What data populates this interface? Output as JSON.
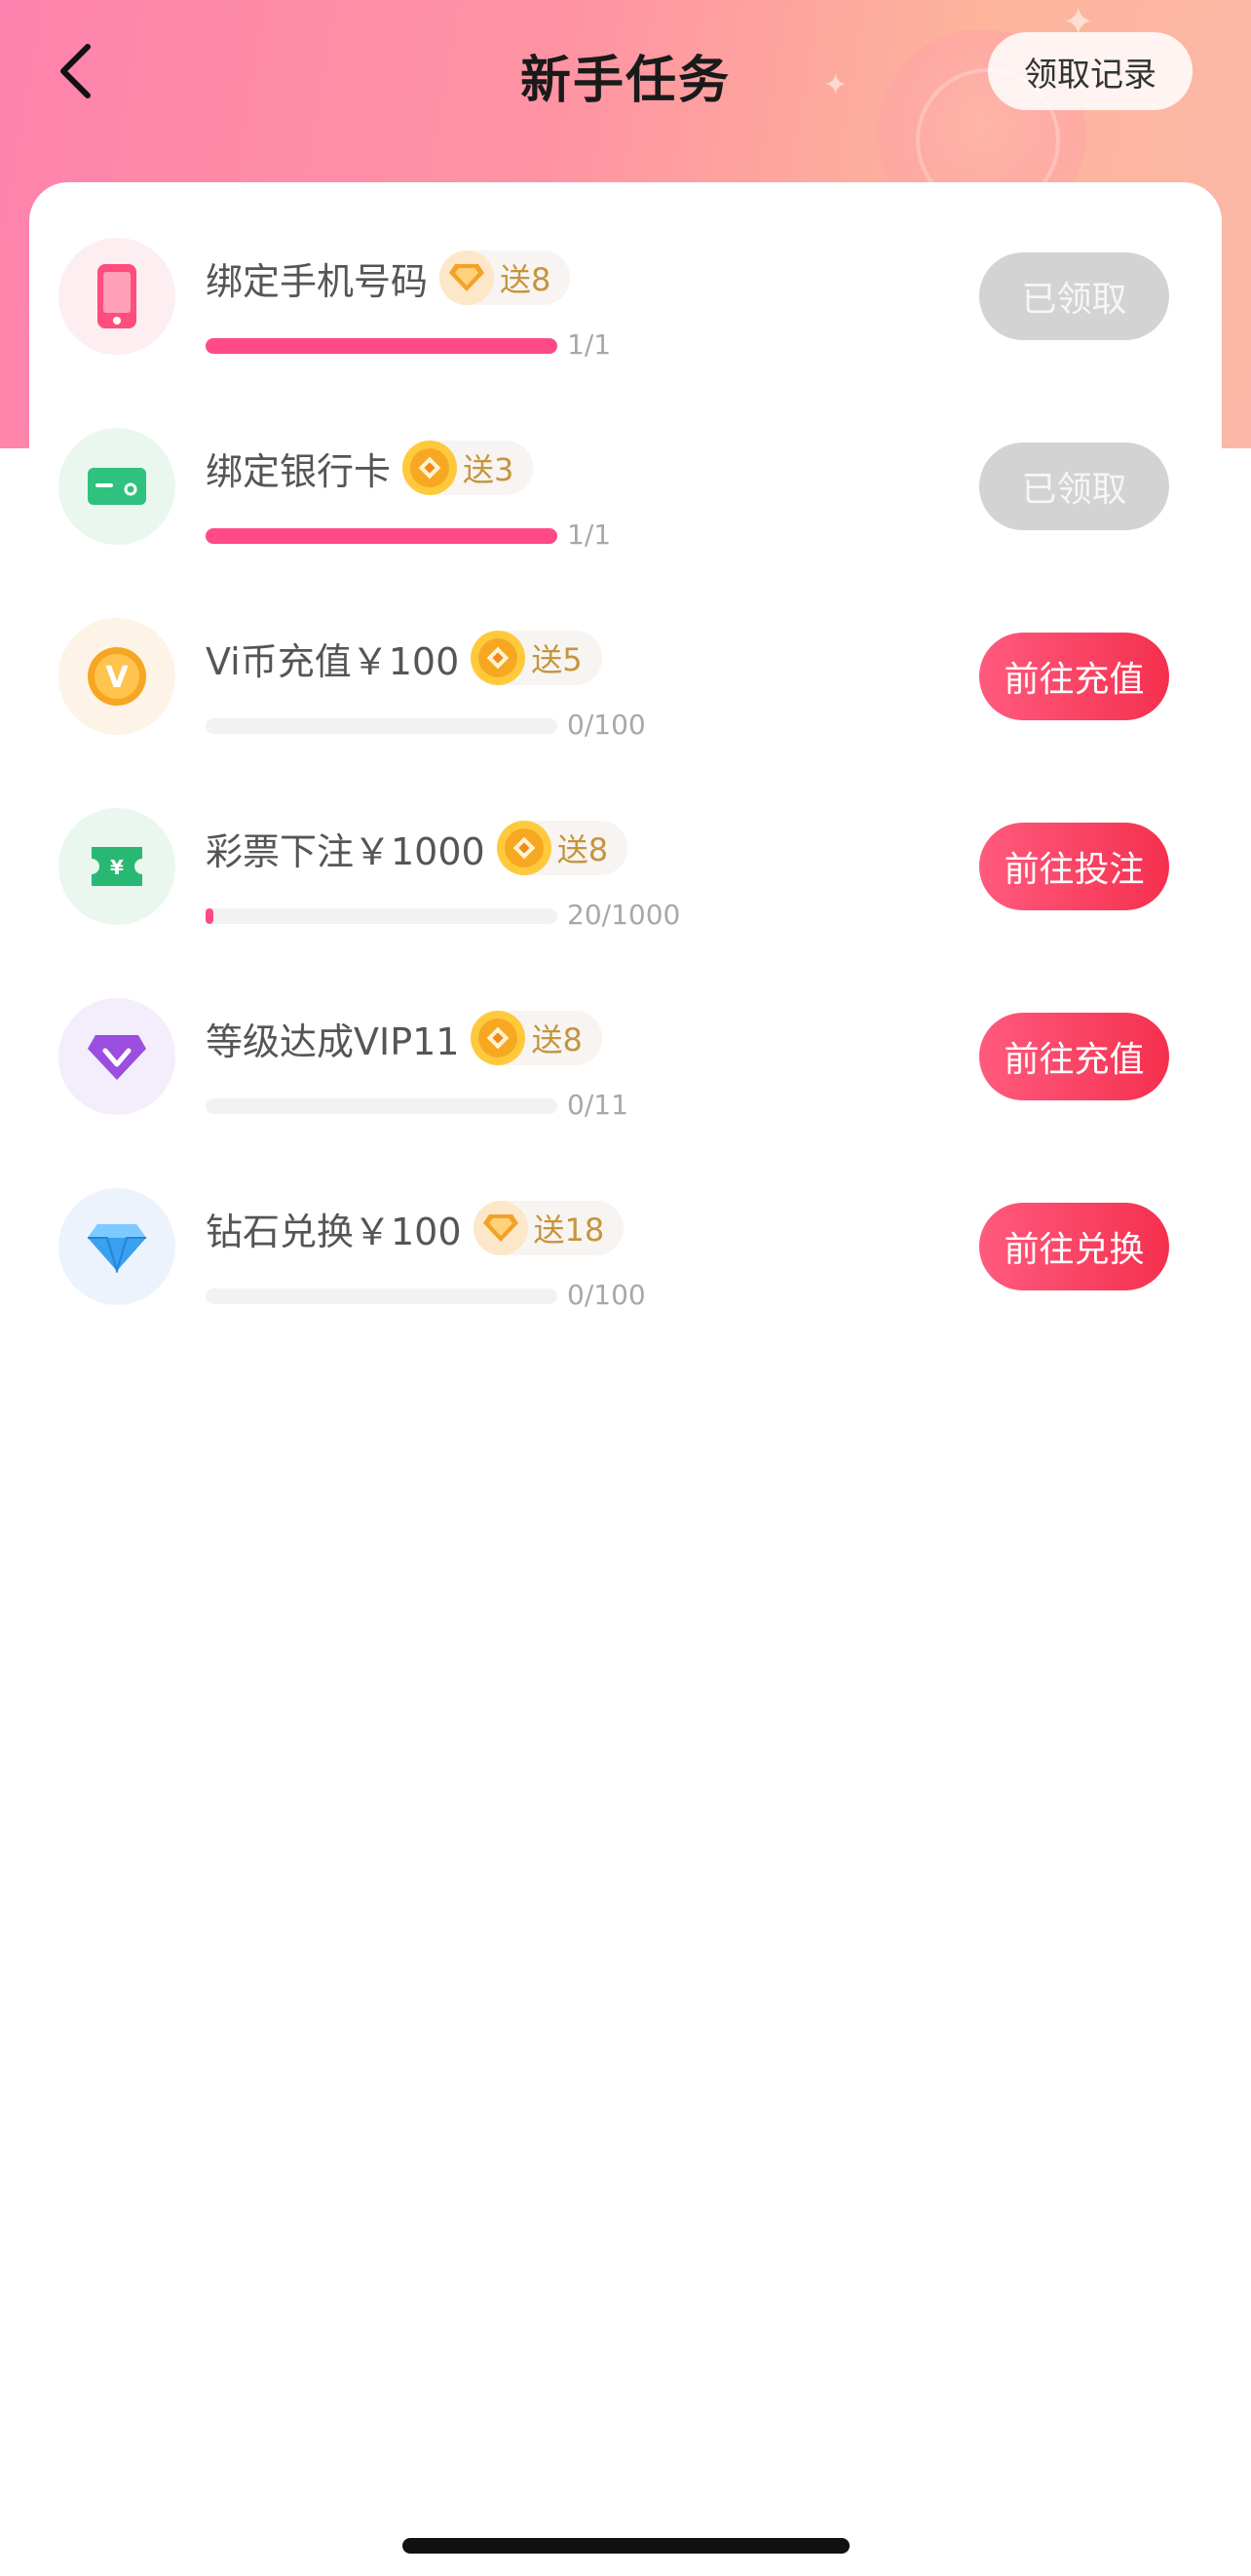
{
  "header": {
    "title": "新手任务",
    "record_label": "领取记录"
  },
  "colors": {
    "accent": "#f5304e",
    "progress": "#ff4a86",
    "reward_text": "#c5953b",
    "claimed_button": "#d3d3d3"
  },
  "tasks": [
    {
      "title": "绑定手机号码",
      "icon": "phone-icon",
      "icon_bg": "#fdeef2",
      "reward_icon": "diamond-icon",
      "reward": "送8",
      "progress_label": "1/1",
      "progress": 1.0,
      "button": "已领取",
      "button_state": "claimed"
    },
    {
      "title": "绑定银行卡",
      "icon": "bank-card-icon",
      "icon_bg": "#eaf7ef",
      "reward_icon": "coin-icon",
      "reward": "送3",
      "progress_label": "1/1",
      "progress": 1.0,
      "button": "已领取",
      "button_state": "claimed"
    },
    {
      "title": "Vi币充值￥100",
      "icon": "vi-coin-icon",
      "icon_bg": "#fdf3e6",
      "reward_icon": "coin-icon",
      "reward": "送5",
      "progress_label": "0/100",
      "progress": 0.0,
      "button": "前往充值",
      "button_state": "active"
    },
    {
      "title": "彩票下注￥1000",
      "icon": "lottery-ticket-icon",
      "icon_bg": "#eaf7ef",
      "reward_icon": "coin-icon",
      "reward": "送8",
      "progress_label": "20/1000",
      "progress": 0.02,
      "button": "前往投注",
      "button_state": "active"
    },
    {
      "title": "等级达成VIP11",
      "icon": "vip-gem-icon",
      "icon_bg": "#f4edfb",
      "reward_icon": "coin-icon",
      "reward": "送8",
      "progress_label": "0/11",
      "progress": 0.0,
      "button": "前往充值",
      "button_state": "active"
    },
    {
      "title": "钻石兑换￥100",
      "icon": "diamond-icon",
      "icon_bg": "#edf3fd",
      "reward_icon": "diamond-icon",
      "reward": "送18",
      "progress_label": "0/100",
      "progress": 0.0,
      "button": "前往兑换",
      "button_state": "active"
    }
  ]
}
